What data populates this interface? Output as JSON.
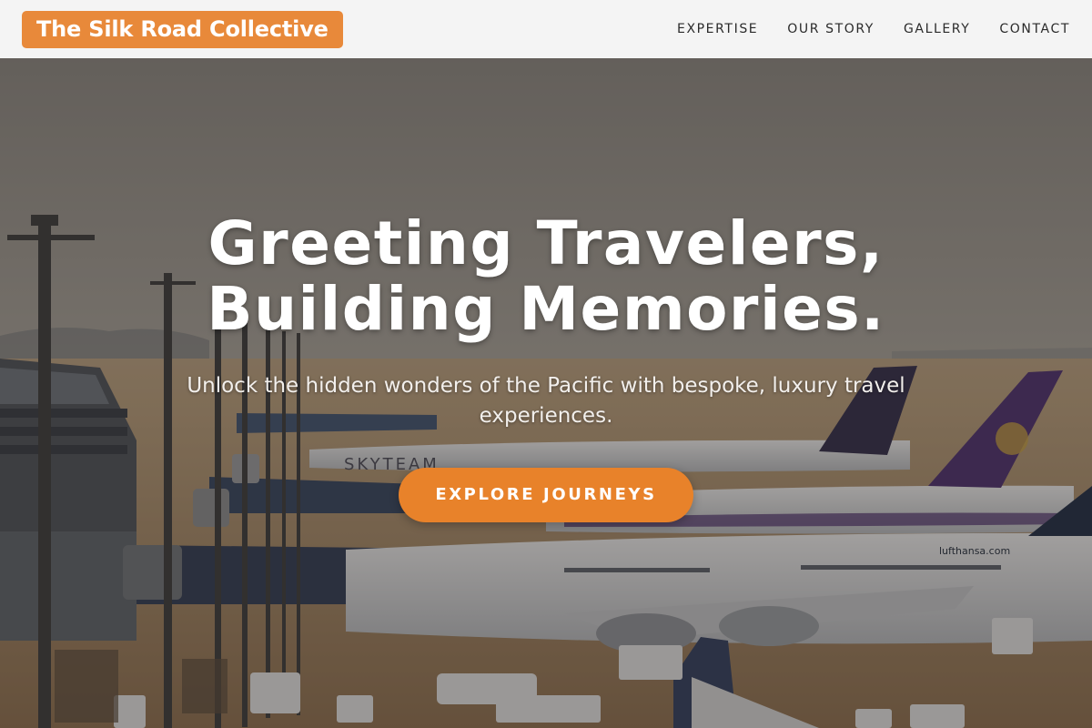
{
  "brand": {
    "name": "The Silk Road Collective"
  },
  "nav": {
    "items": [
      {
        "label": "EXPERTISE"
      },
      {
        "label": "OUR STORY"
      },
      {
        "label": "GALLERY"
      },
      {
        "label": "CONTACT"
      }
    ]
  },
  "hero": {
    "title_line1": "Greeting Travelers,",
    "title_line2": "Building Memories.",
    "subtitle": "Unlock the hidden wonders of the Pacific with bespoke, luxury travel experiences.",
    "cta_label": "EXPLORE JOURNEYS",
    "plane_labels": {
      "skyteam": "SKYTEAM",
      "lufthansa": "lufthansa.com"
    },
    "background_image": "airport-apron-with-parked-airliners"
  },
  "colors": {
    "brand_orange": "#e8893a",
    "cta_orange": "#e8822a",
    "header_bg": "#f4f4f4"
  }
}
